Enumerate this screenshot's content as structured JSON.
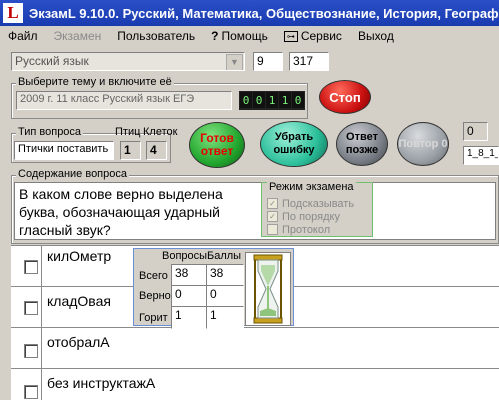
{
  "window": {
    "title": "ЭкзамL 9.10.0. Русский, Математика, Обществознание, История, География, Физика, ",
    "logo_letter": "L"
  },
  "menu": {
    "file": "Файл",
    "exam": "Экзамен",
    "user": "Пользователь",
    "help": "Помощь",
    "service": "Сервис",
    "exit": "Выход"
  },
  "subject": {
    "value": "Русский язык"
  },
  "counters": {
    "a": "9",
    "b": "317"
  },
  "topic": {
    "label": "Выберите тему и включите её",
    "value": "2009 г. 11 класс Русский язык ЕГЭ",
    "digits": [
      "0",
      "0",
      "1",
      "1",
      "0"
    ]
  },
  "buttons": {
    "stop": "Стоп",
    "ready": "Готов ответ",
    "remove_error": "Убрать ошибку",
    "answer_later": "Ответ позже",
    "repeat": "Повтор 0"
  },
  "qtype": {
    "label": "Тип вопроса",
    "value": "Птички поставить",
    "birds_label": "Птиц",
    "birds": "1",
    "cells_label": "Клеток",
    "cells": "4"
  },
  "right_fields": {
    "top": "0",
    "bottom": "1_8_1_"
  },
  "question": {
    "label": "Содержание вопроса",
    "text": "В каком слове верно выделена буква, обозначающая ударный гласный звук?"
  },
  "exam_mode": {
    "label": "Режим экзамена",
    "options": [
      {
        "label": "Подсказывать",
        "checked": true
      },
      {
        "label": "По порядку",
        "checked": true
      },
      {
        "label": "Протокол",
        "checked": false
      }
    ]
  },
  "answers": [
    "килОметр",
    "кладОвая",
    "отобралА",
    "без инструктажА"
  ],
  "stats": {
    "col_questions": "Вопросы",
    "col_points": "Баллы",
    "rows": [
      {
        "label": "Всего",
        "questions": "38",
        "points": "38"
      },
      {
        "label": "Верно",
        "questions": "0",
        "points": "0"
      },
      {
        "label": "Горит",
        "questions": "1",
        "points": "1"
      }
    ]
  },
  "colors": {
    "title_bar": "#1a3bb0",
    "stop": "#cc1111",
    "ready": "#22a62e",
    "remove": "#2bbf9a",
    "later": "#7a7f87",
    "repeat": "#9aa0a6",
    "ready_text": "#e80000"
  }
}
